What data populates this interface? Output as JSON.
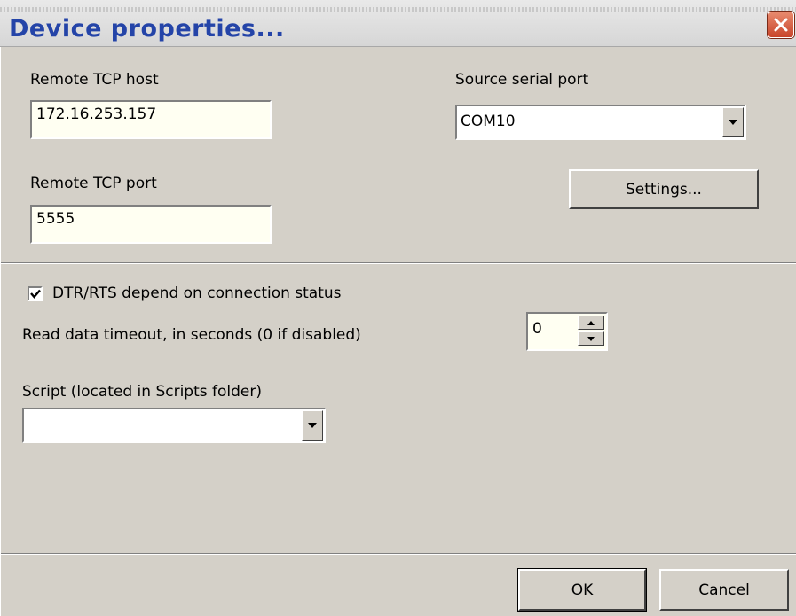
{
  "window": {
    "title": "Device properties...",
    "close_icon": "close-icon"
  },
  "fields": {
    "remote_host_label": "Remote TCP host",
    "remote_host_value": "172.16.253.157",
    "remote_port_label": "Remote TCP port",
    "remote_port_value": "5555",
    "serial_port_label": "Source serial port",
    "serial_port_value": "COM10",
    "settings_button": "Settings..."
  },
  "options": {
    "dtr_rts_label": "DTR/RTS depend on connection status",
    "dtr_rts_checked": true,
    "timeout_label": "Read data timeout, in seconds (0 if disabled)",
    "timeout_value": "0",
    "script_label": "Script (located in Scripts folder)",
    "script_value": ""
  },
  "buttons": {
    "ok": "OK",
    "cancel": "Cancel"
  },
  "colors": {
    "title_text": "#2444a8",
    "dialog_bg": "#d4d0c8",
    "input_bg": "#fffff2"
  }
}
